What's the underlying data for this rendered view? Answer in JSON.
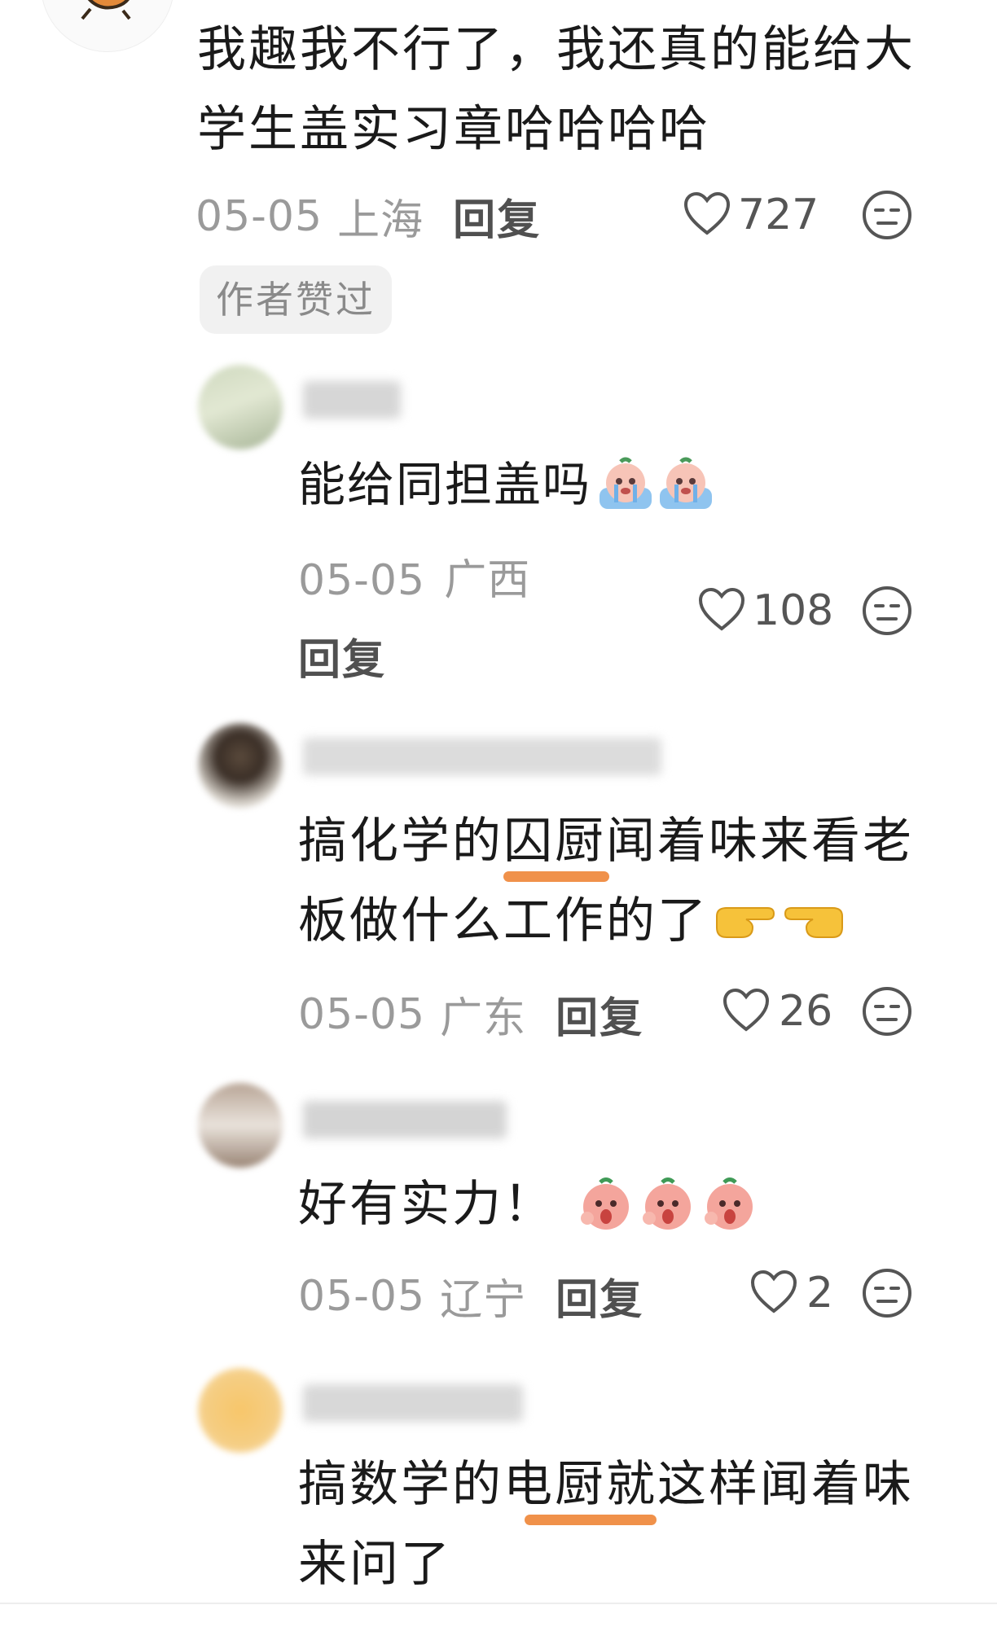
{
  "comments": [
    {
      "text_line1": "我趣我不行了，我还真的能给大",
      "text_line2": "学生盖实习章哈哈哈哈",
      "date": "05-05",
      "location": "上海",
      "reply_label": "回复",
      "likes": "727",
      "badge": "作者赞过"
    },
    {
      "text": "能给同担盖吗",
      "date": "05-05",
      "location": "广西",
      "reply_label": "回复",
      "likes": "108",
      "emojis": [
        "crying-face-emoji",
        "crying-face-emoji"
      ]
    },
    {
      "text_line1": "搞化学的囚厨闻着味来看老",
      "text_line2": "板做什么工作的了",
      "date": "05-05",
      "location": "广东",
      "reply_label": "回复",
      "likes": "26",
      "emojis": [
        "pointing-right-emoji",
        "pointing-left-emoji"
      ]
    },
    {
      "text": "好有实力！",
      "date": "05-05",
      "location": "辽宁",
      "reply_label": "回复",
      "likes": "2",
      "emojis": [
        "shocked-face-emoji",
        "shocked-face-emoji",
        "shocked-face-emoji"
      ]
    },
    {
      "text_line1": "搞数学的电厨就这样闻着味",
      "text_line2": "来问了"
    }
  ],
  "icons": {
    "like": "heart-outline-icon",
    "dislike": "neutral-face-icon"
  },
  "colors": {
    "underline": "#f0914a",
    "meta_text": "#9a9a9a",
    "badge_bg": "#f1f1f1"
  }
}
